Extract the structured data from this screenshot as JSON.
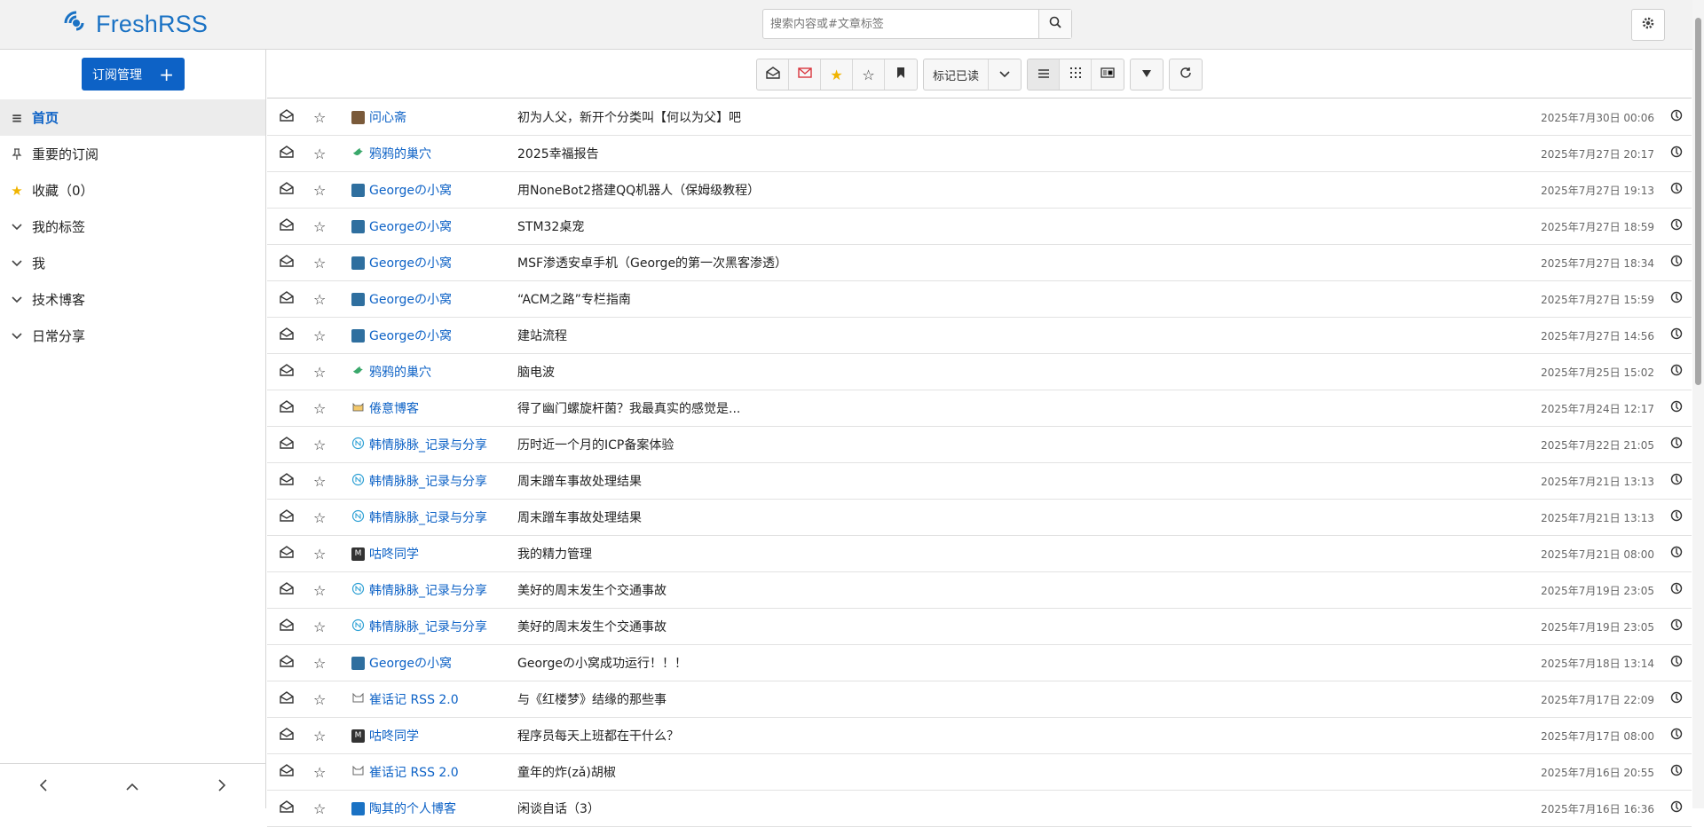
{
  "header": {
    "logo_text": "FreshRSS",
    "search_placeholder": "搜索内容或#文章标签",
    "brand_color": "#1a72c4"
  },
  "sidebar": {
    "subscriptions_button": "订阅管理",
    "items": [
      {
        "label": "首页",
        "icon": "list-icon",
        "active": true
      },
      {
        "label": "重要的订阅",
        "icon": "pin-icon"
      },
      {
        "label": "收藏（0）",
        "icon": "star-icon"
      },
      {
        "label": "我的标签",
        "icon": "chevron-down-icon"
      },
      {
        "label": "我",
        "icon": "chevron-down-icon"
      },
      {
        "label": "技术博客",
        "icon": "chevron-down-icon"
      },
      {
        "label": "日常分享",
        "icon": "chevron-down-icon"
      }
    ]
  },
  "toolbar": {
    "mark_read_label": "标记已读"
  },
  "entries": [
    {
      "source": "问心斋",
      "fav": "photo",
      "title": "初为人父，新开个分类叫【何以为父】吧",
      "date": "2025年7月30日 00:06"
    },
    {
      "source": "鸦鸦的巢穴",
      "fav": "bird",
      "title": "2025幸福报告",
      "date": "2025年7月27日 20:17"
    },
    {
      "source": "Georgeの小窝",
      "fav": "avatar",
      "title": "用NoneBot2搭建QQ机器人（保姆级教程）",
      "date": "2025年7月27日 19:13"
    },
    {
      "source": "Georgeの小窝",
      "fav": "avatar",
      "title": "STM32桌宠",
      "date": "2025年7月27日 18:59"
    },
    {
      "source": "Georgeの小窝",
      "fav": "avatar",
      "title": "MSF渗透安卓手机（George的第一次黑客渗透）",
      "date": "2025年7月27日 18:34"
    },
    {
      "source": "Georgeの小窝",
      "fav": "avatar",
      "title": "“ACM之路”专栏指南",
      "date": "2025年7月27日 15:59"
    },
    {
      "source": "Georgeの小窝",
      "fav": "avatar",
      "title": "建站流程",
      "date": "2025年7月27日 14:56"
    },
    {
      "source": "鸦鸦的巢穴",
      "fav": "bird",
      "title": "脑电波",
      "date": "2025年7月25日 15:02"
    },
    {
      "source": "倦意博客",
      "fav": "cat",
      "title": "得了幽门螺旋杆菌？我最真实的感觉是...",
      "date": "2025年7月24日 12:17"
    },
    {
      "source": "韩情脉脉_记录与分享",
      "fav": "circle",
      "title": "历时近一个月的ICP备案体验",
      "date": "2025年7月22日 21:05"
    },
    {
      "source": "韩情脉脉_记录与分享",
      "fav": "circle",
      "title": "周末蹭车事故处理结果",
      "date": "2025年7月21日 13:13"
    },
    {
      "source": "韩情脉脉_记录与分享",
      "fav": "circle",
      "title": "周末蹭车事故处理结果",
      "date": "2025年7月21日 13:13"
    },
    {
      "source": "咕咚同学",
      "fav": "m",
      "title": "我的精力管理",
      "date": "2025年7月21日 08:00"
    },
    {
      "source": "韩情脉脉_记录与分享",
      "fav": "circle",
      "title": "美好的周末发生个交通事故",
      "date": "2025年7月19日 23:05"
    },
    {
      "source": "韩情脉脉_记录与分享",
      "fav": "circle",
      "title": "美好的周末发生个交通事故",
      "date": "2025年7月19日 23:05"
    },
    {
      "source": "Georgeの小窝",
      "fav": "avatar",
      "title": "Georgeの小窝成功运行！！！",
      "date": "2025年7月18日 13:14"
    },
    {
      "source": "崔话记 RSS 2.0",
      "fav": "cat2",
      "title": "与《红楼梦》结缘的那些事",
      "date": "2025年7月17日 22:09"
    },
    {
      "source": "咕咚同学",
      "fav": "m",
      "title": "程序员每天上班都在干什么？",
      "date": "2025年7月17日 08:00"
    },
    {
      "source": "崔话记 RSS 2.0",
      "fav": "cat2",
      "title": "童年的炸(zǎ)胡椒",
      "date": "2025年7月16日 20:55"
    },
    {
      "source": "陶其的个人博客",
      "fav": "blue",
      "title": "闲谈自话（3）",
      "date": "2025年7月16日 16:36"
    }
  ]
}
